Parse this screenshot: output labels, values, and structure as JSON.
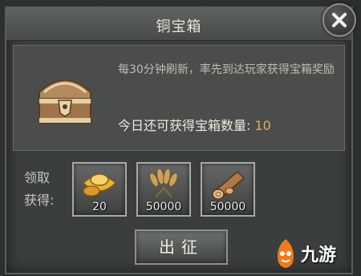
{
  "dialog": {
    "title": "铜宝箱",
    "description": "每30分钟刷新，率先到达玩家获得宝箱奖励",
    "count_label": "今日还可获得宝箱数量:",
    "count_value": "10"
  },
  "rewards": {
    "label_line1": "领取",
    "label_line2": "获得:",
    "items": [
      {
        "name": "gold-ingot",
        "qty": "20"
      },
      {
        "name": "wheat",
        "qty": "50000"
      },
      {
        "name": "wood-log",
        "qty": "50000"
      }
    ]
  },
  "actions": {
    "go_label": "出征"
  },
  "watermark": {
    "text": "九游"
  },
  "colors": {
    "count_accent": "#e0b14b"
  }
}
